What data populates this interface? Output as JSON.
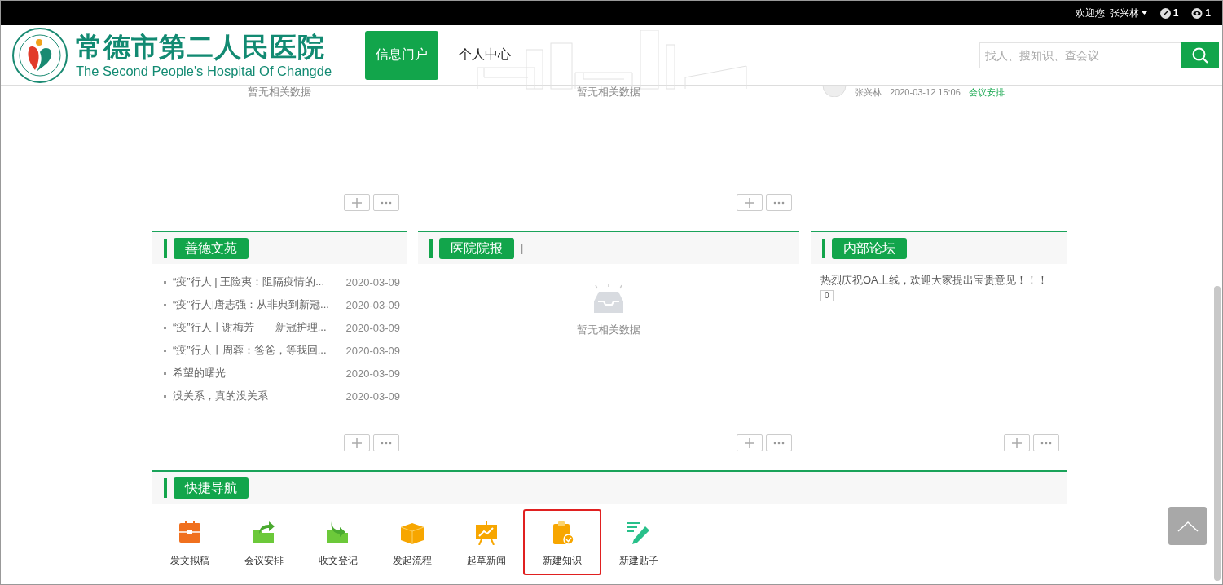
{
  "top_bar": {
    "greeting": "欢迎您",
    "user": "张兴林",
    "badges": [
      {
        "kind": "edit",
        "count": "1"
      },
      {
        "kind": "view",
        "count": "1"
      }
    ]
  },
  "header": {
    "logo_title": "常德市第二人民医院",
    "logo_subtitle": "The Second People's Hospital Of Changde",
    "nav": [
      {
        "label": "信息门户",
        "selected": true
      },
      {
        "label": "个人中心",
        "selected": false
      }
    ],
    "search": {
      "placeholder": "找人、搜知识、查会议"
    }
  },
  "top_row": [
    {
      "kind": "empty",
      "text": "暂无相关数据"
    },
    {
      "kind": "empty",
      "text": "暂无相关数据"
    },
    {
      "kind": "post",
      "author": "张兴林",
      "time": "2020-03-12 15:06",
      "tag": "会议安排"
    }
  ],
  "panels": [
    {
      "kind": "list",
      "title": "善德文苑",
      "items": [
        {
          "title": "“疫”行人 | 王险夷：阻隔疫情的...",
          "date": "2020-03-09"
        },
        {
          "title": "“疫”行人|唐志强：从非典到新冠...",
          "date": "2020-03-09"
        },
        {
          "title": "“疫”行人丨谢梅芳——新冠护理...",
          "date": "2020-03-09"
        },
        {
          "title": "“疫”行人丨周蓉：爸爸，等我回...",
          "date": "2020-03-09"
        },
        {
          "title": "希望的曙光",
          "date": "2020-03-09"
        },
        {
          "title": "没关系，真的没关系",
          "date": "2020-03-09"
        }
      ]
    },
    {
      "kind": "empty",
      "title": "医院院报",
      "title_suffix": "|",
      "empty_text": "暂无相关数据"
    },
    {
      "kind": "forum",
      "title": "内部论坛",
      "posts": [
        {
          "title": "热烈庆祝OA上线，欢迎大家提出宝贵意见！！！",
          "comments": "0"
        }
      ]
    }
  ],
  "quick_nav": {
    "title": "快捷导航",
    "items": [
      {
        "kind": "toolbox",
        "label": "发文拟稿",
        "highlighted": false
      },
      {
        "kind": "outbox",
        "label": "会议安排",
        "highlighted": false
      },
      {
        "kind": "inbox",
        "label": "收文登记",
        "highlighted": false
      },
      {
        "kind": "box",
        "label": "发起流程",
        "highlighted": false
      },
      {
        "kind": "easel",
        "label": "起草新闻",
        "highlighted": false
      },
      {
        "kind": "clipboard",
        "label": "新建知识",
        "highlighted": true
      },
      {
        "kind": "pencil",
        "label": "新建贴子",
        "highlighted": false
      }
    ]
  }
}
